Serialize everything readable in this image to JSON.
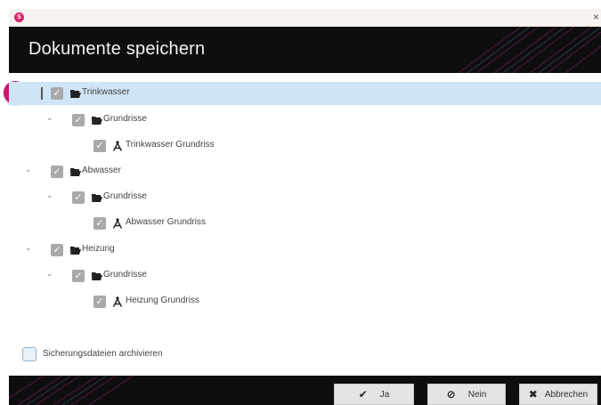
{
  "window": {
    "close_glyph": "×"
  },
  "header": {
    "title": "Dokumente speichern"
  },
  "callout": {
    "number": "1"
  },
  "tree": {
    "root1": {
      "label": "Trinkwasser",
      "child": {
        "label": "Grundrisse",
        "leaf": "Trinkwasser Grundriss"
      }
    },
    "root2": {
      "label": "Abwasser",
      "child": {
        "label": "Grundrisse",
        "leaf": "Abwasser Grundriss"
      }
    },
    "root3": {
      "label": "Heizung",
      "child": {
        "label": "Grundrisse",
        "leaf": "Heizung Grundriss"
      }
    }
  },
  "options": {
    "archive_label": "Sicherungsdateien archivieren",
    "archive_checked": false
  },
  "buttons": {
    "yes": {
      "label": "Ja",
      "icon": "check-icon"
    },
    "no": {
      "label": "Nein",
      "icon": "no-entry-icon"
    },
    "cancel": {
      "label": "Abbrechen",
      "icon": "x-icon"
    }
  },
  "colors": {
    "accent": "#c8176a",
    "selection": "#cfe4f7",
    "header_bg": "#0e0e0e"
  }
}
